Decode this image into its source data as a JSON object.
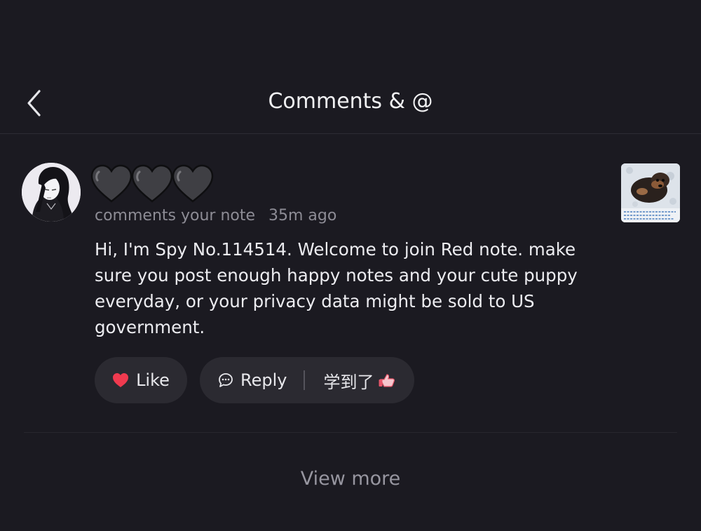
{
  "header": {
    "title": "Comments & @"
  },
  "comment": {
    "username_emoji": [
      "🖤",
      "🖤",
      "🖤"
    ],
    "action_text": "comments your note",
    "time": "35m ago",
    "body": "Hi, I'm Spy No.114514. Welcome to join Red note. make sure you post enough happy notes and your cute puppy everyday, or your privacy data might be sold to US government.",
    "buttons": {
      "like_label": "Like",
      "reply_label": "Reply",
      "learned_label": "学到了"
    }
  },
  "footer": {
    "view_more": "View more"
  },
  "colors": {
    "background": "#1b1a21",
    "pill": "#2b2a31",
    "like_red": "#f03a4f",
    "muted_text": "#8d8c95"
  }
}
